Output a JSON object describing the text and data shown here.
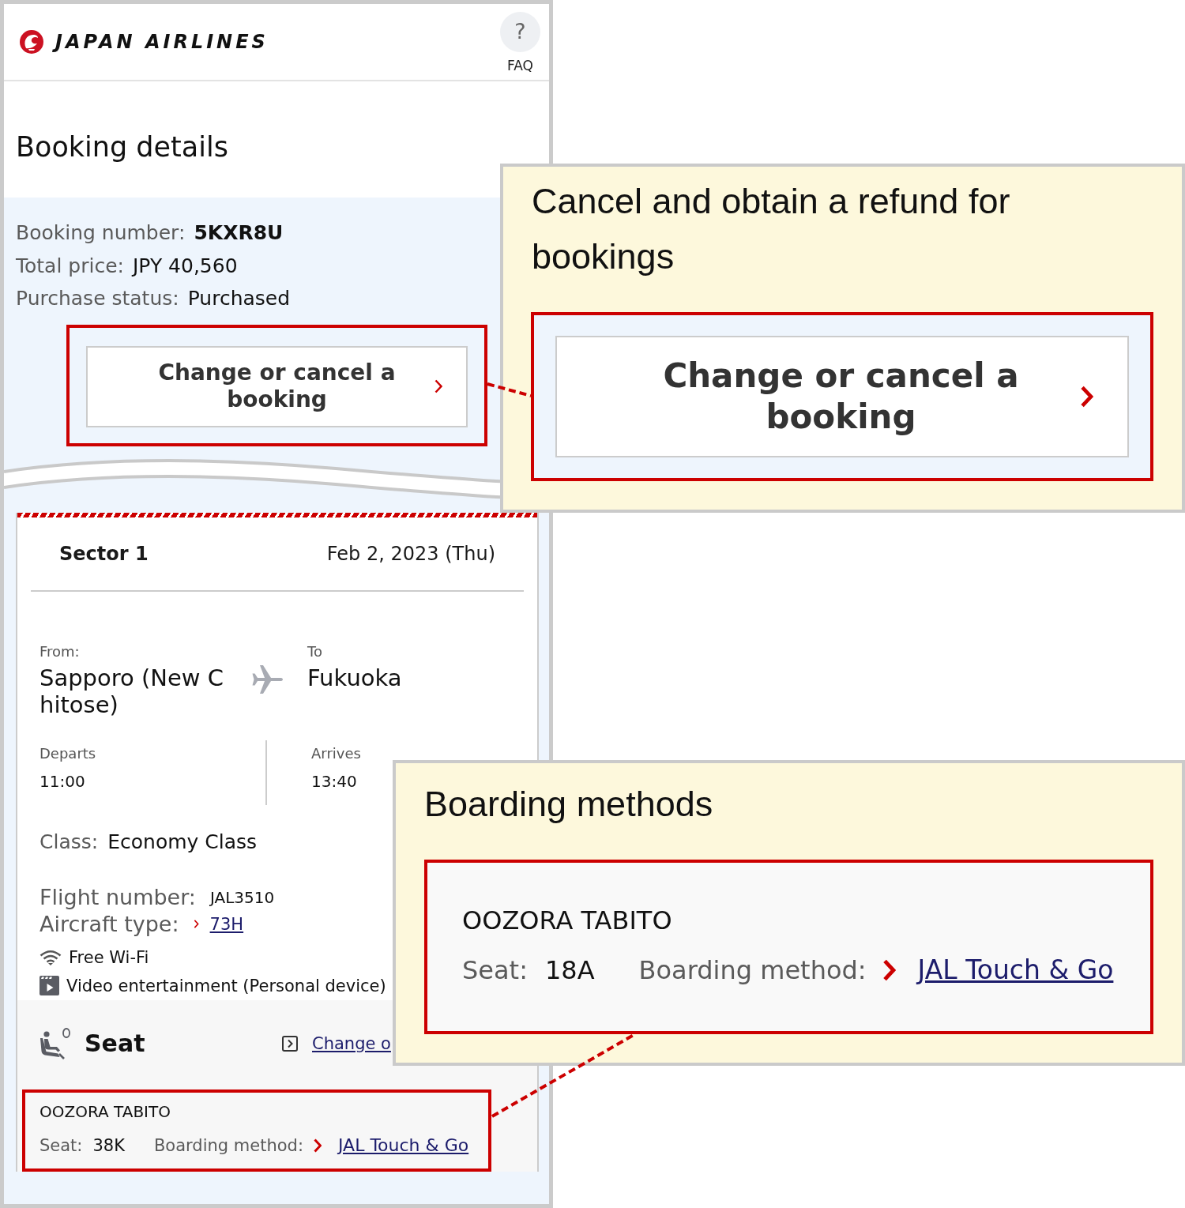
{
  "header": {
    "logo_text": "JAPAN AIRLINES",
    "faq": {
      "icon": "?",
      "label": "FAQ"
    }
  },
  "page_title": "Booking details",
  "booking": {
    "fields": [
      {
        "label": "Booking number:",
        "value": "5KXR8U",
        "emphasized": true
      },
      {
        "label": "Total price:",
        "value": "JPY 40,560",
        "emphasized": false
      },
      {
        "label": "Purchase status:",
        "value": "Purchased",
        "emphasized": false
      }
    ],
    "change_button": "Change or cancel a booking"
  },
  "sector": {
    "title": "Sector 1",
    "date": "Feb 2, 2023 (Thu)",
    "from_label": "From:",
    "from": "Sapporo (New Chitose)",
    "to_label": "To",
    "to": "Fukuoka",
    "departs_label": "Departs",
    "departs": "11:00",
    "arrives_label": "Arrives",
    "arrives": "13:40",
    "class_label": "Class:",
    "class": "Economy Class",
    "flight_number_label": "Flight number:",
    "flight_number": "JAL3510",
    "aircraft_label": "Aircraft type:",
    "aircraft": "73H",
    "amenities": [
      {
        "kind": "wifi",
        "label": "Free Wi-Fi"
      },
      {
        "kind": "video",
        "label": "Video entertainment (Personal device)"
      }
    ]
  },
  "seat": {
    "title": "Seat",
    "change_link": "Change o",
    "passenger": {
      "name": "OOZORA TABITO",
      "seat_label": "Seat:",
      "seat": "38K",
      "boarding_label": "Boarding method:",
      "boarding": "JAL Touch & Go"
    }
  },
  "callouts": [
    {
      "kind": "button",
      "title": "Cancel and obtain a refund for bookings",
      "button": "Change or cancel a booking"
    },
    {
      "kind": "passenger",
      "title": "Boarding methods",
      "name": "OOZORA TABITO",
      "seat_label": "Seat:",
      "seat": "18A",
      "boarding_label": "Boarding method:",
      "boarding": "JAL Touch & Go"
    }
  ]
}
